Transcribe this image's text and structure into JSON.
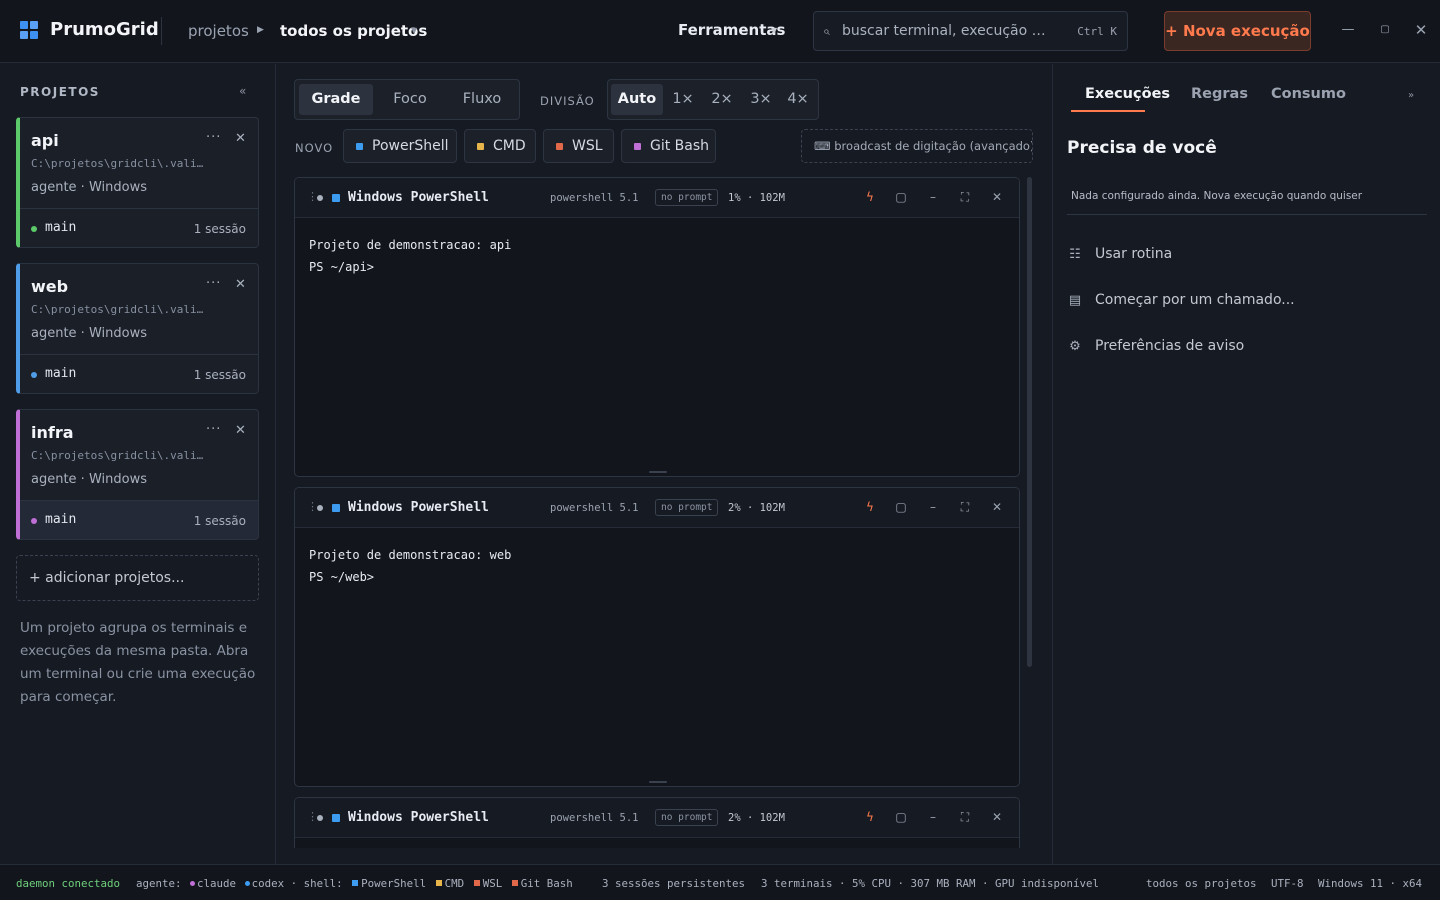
{
  "header": {
    "brand": "PrumoGrid",
    "breadcrumb_root": "projetos",
    "breadcrumb_current": "todos os projetos",
    "tools_label": "Ferramentas",
    "search_placeholder": "buscar terminal, execução ou spec...",
    "search_shortcut": "Ctrl K",
    "new_run_label": "+ Nova execução",
    "accent": "#ff7a4d"
  },
  "sidebar": {
    "title": "PROJETOS",
    "collapse_icon": "«",
    "projects": [
      {
        "name": "api",
        "path": "C:\\projetos\\gridcli\\.vali…",
        "agent": "agente · Windows",
        "branch": "main",
        "sessions": "1 sessão",
        "color": "#5cc96a",
        "active": false
      },
      {
        "name": "web",
        "path": "C:\\projetos\\gridcli\\.vali…",
        "agent": "agente · Windows",
        "branch": "main",
        "sessions": "1 sessão",
        "color": "#4f9de8",
        "active": false
      },
      {
        "name": "infra",
        "path": "C:\\projetos\\gridcli\\.vali…",
        "agent": "agente · Windows",
        "branch": "main",
        "sessions": "1 sessão",
        "color": "#c06fd6",
        "active": true
      }
    ],
    "add_label": "+ adicionar projetos...",
    "help_text": "Um projeto agrupa os terminais e execuções da mesma pasta. Abra um terminal ou crie uma execução para começar."
  },
  "main": {
    "view_modes": [
      "Grade",
      "Foco",
      "Fluxo"
    ],
    "view_active": "Grade",
    "division_label": "DIVISÃO",
    "divisions": [
      "Auto",
      "1×",
      "2×",
      "3×",
      "4×"
    ],
    "division_active": "Auto",
    "new_label": "NOVO",
    "shells": [
      {
        "label": "PowerShell",
        "color": "#3d9cf0"
      },
      {
        "label": "CMD",
        "color": "#e8b54a"
      },
      {
        "label": "WSL",
        "color": "#e2684a"
      },
      {
        "label": "Git Bash",
        "color": "#c06fd6"
      }
    ],
    "broadcast_label": "⌨ broadcast de digitação (avançado)...",
    "terminals": [
      {
        "title": "Windows PowerShell",
        "version": "powershell 5.1",
        "badge": "no prompt",
        "stats": "1% · 102M",
        "lines": [
          "Projeto de demonstracao: api",
          "PS ~/api>"
        ]
      },
      {
        "title": "Windows PowerShell",
        "version": "powershell 5.1",
        "badge": "no prompt",
        "stats": "2% · 102M",
        "lines": [
          "Projeto de demonstracao: web",
          "PS ~/web>"
        ]
      },
      {
        "title": "Windows PowerShell",
        "version": "powershell 5.1",
        "badge": "no prompt",
        "stats": "2% · 102M",
        "lines": []
      }
    ]
  },
  "right": {
    "tabs": [
      "Execuções",
      "Regras",
      "Consumo"
    ],
    "active_tab": "Execuções",
    "collapse_icon": "»",
    "title": "Precisa de você",
    "empty_text": "Nada configurado ainda. Nova execução quando quiser",
    "actions": [
      {
        "label": "Usar rotina",
        "icon": "list-checks-icon"
      },
      {
        "label": "Começar por um chamado...",
        "icon": "document-icon"
      },
      {
        "label": "Preferências de aviso",
        "icon": "gear-icon"
      }
    ]
  },
  "statusbar": {
    "daemon": "daemon conectado",
    "agent_label": "agente:",
    "agents": [
      {
        "name": "claude",
        "color": "#c06fd6"
      },
      {
        "name": "codex",
        "color": "#3d9cf0"
      }
    ],
    "shell_label": "shell:",
    "shells": [
      {
        "name": "PowerShell",
        "color": "#3d9cf0"
      },
      {
        "name": "CMD",
        "color": "#e8b54a"
      },
      {
        "name": "WSL",
        "color": "#e2684a"
      },
      {
        "name": "Git Bash",
        "color": "#e2684a"
      }
    ],
    "sessions": "3 sessões persistentes",
    "resources": "3 terminais · 5% CPU · 307 MB RAM · GPU indisponível",
    "scope": "todos os projetos",
    "encoding": "UTF-8",
    "platform": "Windows 11 · x64"
  }
}
